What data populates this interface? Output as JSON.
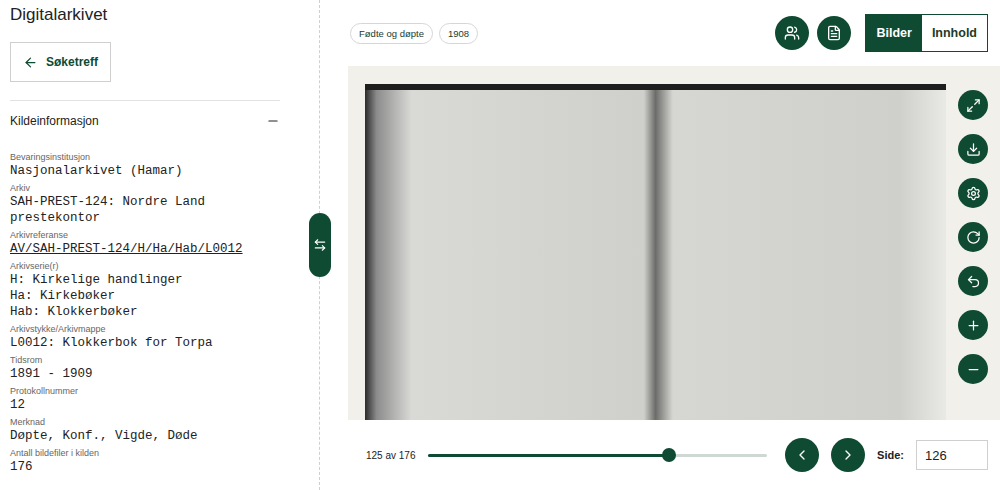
{
  "header": {
    "title": "Digitalarkivet"
  },
  "back_button": {
    "label": "Søketreff"
  },
  "section": {
    "title": "Kildeinformasjon",
    "expanded": true
  },
  "fields": [
    {
      "label": "Bevaringsinstitusjon",
      "values": [
        "Nasjonalarkivet (Hamar)"
      ],
      "link": false
    },
    {
      "label": "Arkiv",
      "values": [
        "SAH-PREST-124: Nordre Land prestekontor"
      ],
      "link": false
    },
    {
      "label": "Arkivreferanse",
      "values": [
        "AV/SAH-PREST-124/H/Ha/Hab/L0012"
      ],
      "link": true
    },
    {
      "label": "Arkivserie(r)",
      "values": [
        "H: Kirkelige handlinger",
        "Ha: Kirkebøker",
        "Hab: Klokkerbøker"
      ],
      "link": false
    },
    {
      "label": "Arkivstykke/Arkivmappe",
      "values": [
        "L0012: Klokkerbok for Torpa"
      ],
      "link": false
    },
    {
      "label": "Tidsrom",
      "values": [
        "1891 - 1909"
      ],
      "link": false
    },
    {
      "label": "Protokollnummer",
      "values": [
        "12"
      ],
      "link": false
    },
    {
      "label": "Merknad",
      "values": [
        "Døpte, Konf., Vigde, Døde"
      ],
      "link": false
    },
    {
      "label": "Antall bildefiler i kilden",
      "values": [
        "176"
      ],
      "link": false
    }
  ],
  "chips": [
    "Fødte og døpte",
    "1908"
  ],
  "view_toggle": [
    {
      "label": "Bilder",
      "selected": true
    },
    {
      "label": "Innhold",
      "selected": false
    }
  ],
  "pager": {
    "position": "125 av 176",
    "level": 0.71,
    "page_label": "Side:",
    "page_value": "126"
  }
}
